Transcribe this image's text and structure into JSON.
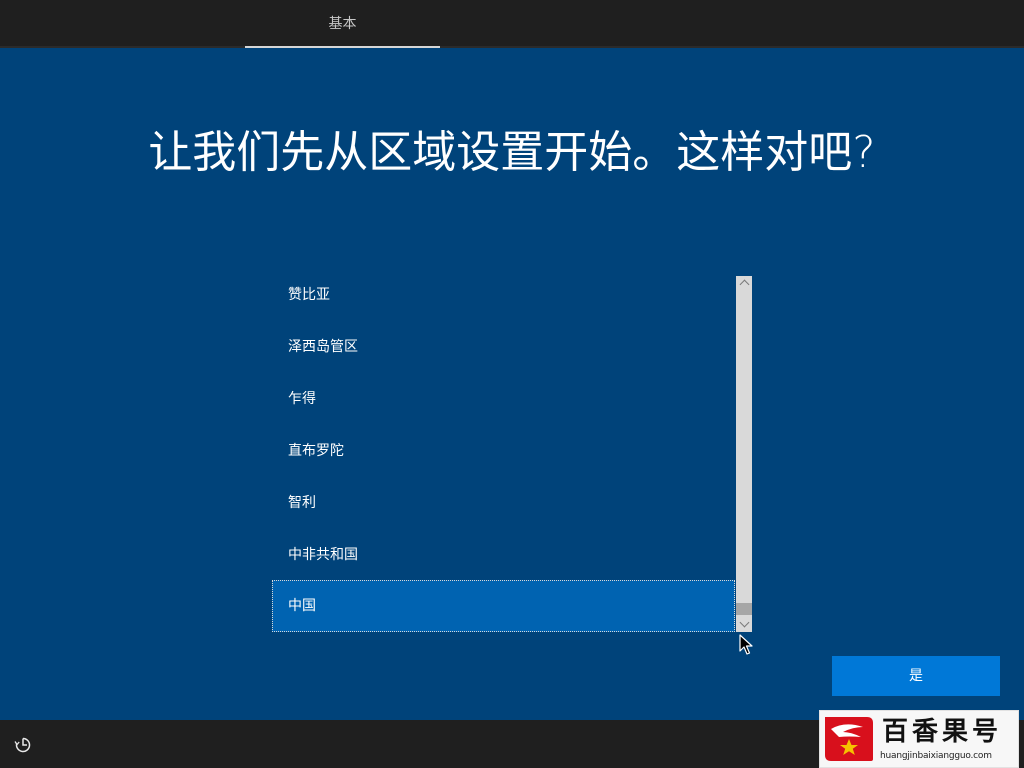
{
  "top_tab": {
    "label": "基本"
  },
  "heading": "让我们先从区域设置开始。这样对吧?",
  "region_list": {
    "items": [
      {
        "label": "赞比亚",
        "selected": false
      },
      {
        "label": "泽西岛管区",
        "selected": false
      },
      {
        "label": "乍得",
        "selected": false
      },
      {
        "label": "直布罗陀",
        "selected": false
      },
      {
        "label": "智利",
        "selected": false
      },
      {
        "label": "中非共和国",
        "selected": false
      },
      {
        "label": "中国",
        "selected": true
      }
    ]
  },
  "yes_button": {
    "label": "是"
  },
  "bottom_bar": {
    "accessibility_icon": "ease-of-access-icon"
  },
  "watermark": {
    "title": "百香果号",
    "url": "huangjinbaixiangguo.com"
  },
  "colors": {
    "background": "#00437a",
    "selection": "#0063b1",
    "button": "#0078d7",
    "bar": "#1f1f1f"
  }
}
